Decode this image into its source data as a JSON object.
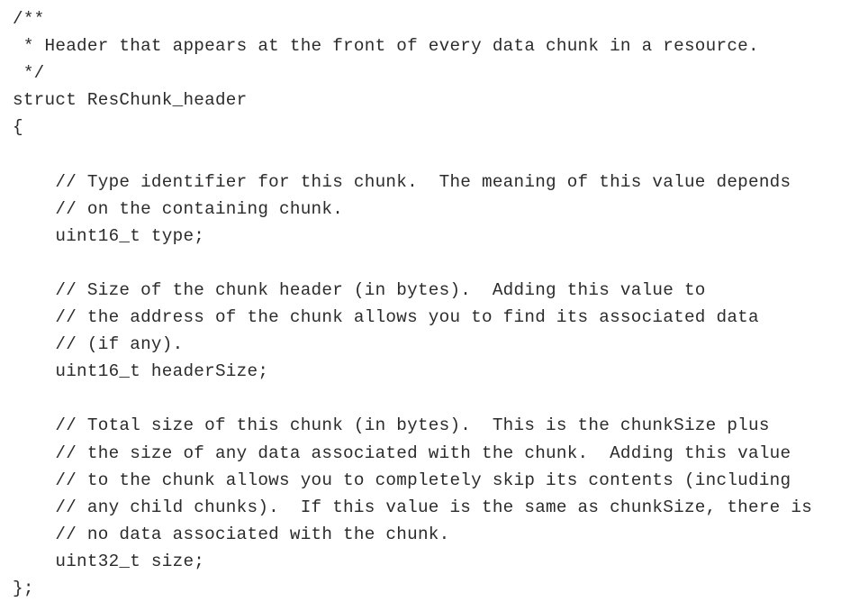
{
  "document": {
    "kind": "source-code-listing",
    "language": "C",
    "background_color": "#ffffff",
    "text_color": "#2b2b2b",
    "struct_name": "ResChunk_header",
    "lines": [
      "/**",
      " * Header that appears at the front of every data chunk in a resource.",
      " */",
      "struct ResChunk_header",
      "{",
      "",
      "    // Type identifier for this chunk.  The meaning of this value depends",
      "    // on the containing chunk.",
      "    uint16_t type;",
      "",
      "    // Size of the chunk header (in bytes).  Adding this value to",
      "    // the address of the chunk allows you to find its associated data",
      "    // (if any).",
      "    uint16_t headerSize;",
      "",
      "    // Total size of this chunk (in bytes).  This is the chunkSize plus",
      "    // the size of any data associated with the chunk.  Adding this value",
      "    // to the chunk allows you to completely skip its contents (including",
      "    // any child chunks).  If this value is the same as chunkSize, there is",
      "    // no data associated with the chunk.",
      "    uint32_t size;",
      "};"
    ],
    "fields": [
      {
        "type": "uint16_t",
        "name": "type"
      },
      {
        "type": "uint16_t",
        "name": "headerSize"
      },
      {
        "type": "uint32_t",
        "name": "size"
      }
    ]
  }
}
